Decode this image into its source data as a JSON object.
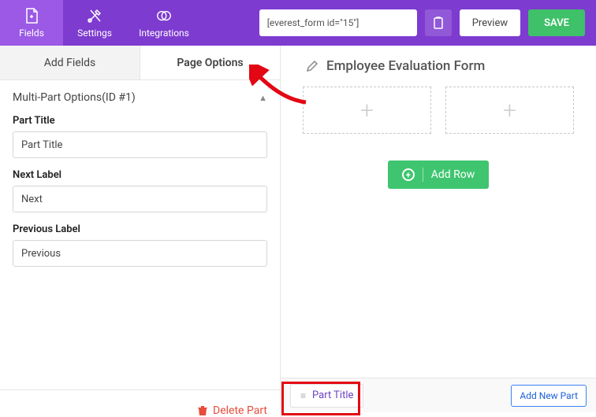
{
  "topnav": {
    "fields": "Fields",
    "settings": "Settings",
    "integrations": "Integrations",
    "shortcode": "[everest_form id=\"15\"]",
    "preview": "Preview",
    "save": "SAVE"
  },
  "side_tabs": {
    "add_fields": "Add Fields",
    "page_options": "Page Options"
  },
  "accordion": {
    "title": "Multi-Part Options(ID #1)"
  },
  "fields": {
    "part_title_label": "Part Title",
    "part_title_value": "Part Title",
    "next_label_label": "Next Label",
    "next_label_value": "Next",
    "prev_label_label": "Previous Label",
    "prev_label_value": "Previous"
  },
  "delete_part": "Delete Part",
  "canvas": {
    "form_title": "Employee Evaluation Form",
    "add_row": "Add Row"
  },
  "parts": {
    "part_tab_label": "Part Title",
    "add_new_part": "Add New Part"
  }
}
